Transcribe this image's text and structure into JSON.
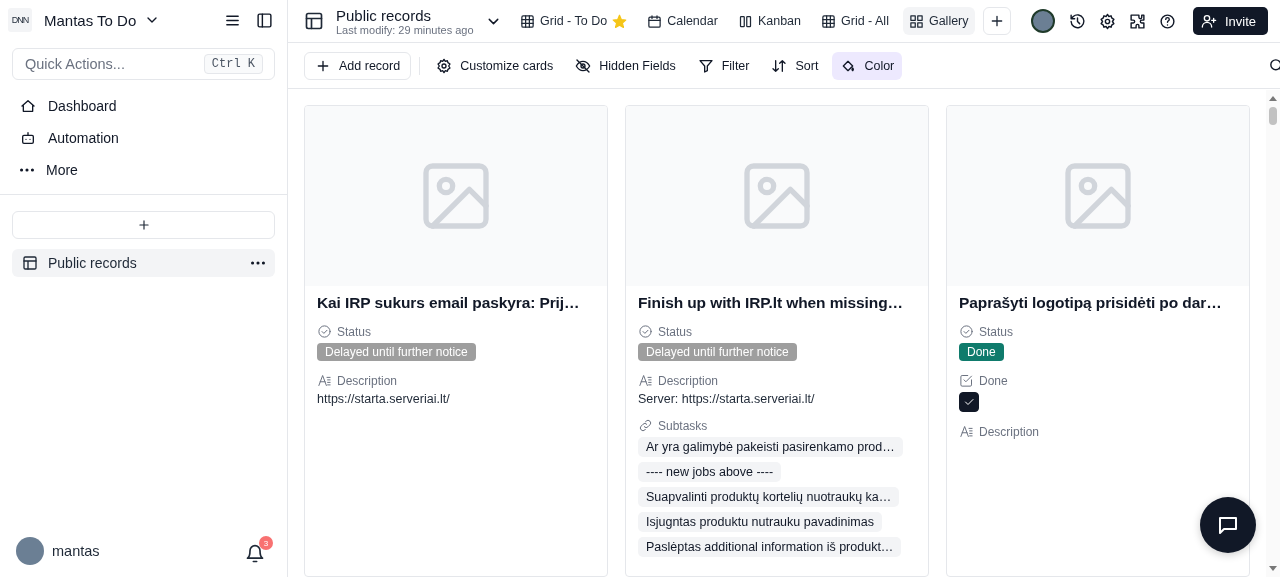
{
  "workspace": {
    "logo": "DNN",
    "name": "Mantas To Do"
  },
  "quick_actions": {
    "placeholder": "Quick Actions...",
    "shortcut": [
      "Ctrl",
      "K"
    ]
  },
  "nav": [
    {
      "label": "Dashboard",
      "kind": "dashboard"
    },
    {
      "label": "Automation",
      "kind": "automation"
    },
    {
      "label": "More",
      "kind": "more"
    }
  ],
  "tables": [
    {
      "label": "Public records",
      "selected": true
    }
  ],
  "user": {
    "name": "mantas",
    "notifications": "3"
  },
  "header": {
    "title": "Public records",
    "subtitle": "Last modify: 29 minutes ago"
  },
  "views": [
    {
      "label": "Grid - To Do",
      "kind": "grid",
      "starred": true,
      "selected": false
    },
    {
      "label": "Calendar",
      "kind": "calendar",
      "starred": false,
      "selected": false
    },
    {
      "label": "Kanban",
      "kind": "kanban",
      "starred": false,
      "selected": false
    },
    {
      "label": "Grid - All",
      "kind": "grid",
      "starred": false,
      "selected": false
    },
    {
      "label": "Gallery",
      "kind": "gallery",
      "starred": false,
      "selected": true
    }
  ],
  "invite": "Invite",
  "toolbar": [
    {
      "label": "Add record",
      "kind": "add",
      "selected": false
    },
    {
      "label": "Customize cards",
      "kind": "customize",
      "selected": false
    },
    {
      "label": "Hidden Fields",
      "kind": "hidden",
      "selected": false
    },
    {
      "label": "Filter",
      "kind": "filter",
      "selected": false
    },
    {
      "label": "Sort",
      "kind": "sort",
      "selected": false
    },
    {
      "label": "Color",
      "kind": "color",
      "selected": true
    }
  ],
  "cards": [
    {
      "title": "Kai IRP sukurs email paskyra: Prij…",
      "fields": [
        {
          "label": "Status",
          "kind": "status",
          "value": "Delayed until further notice",
          "color": "#9e9e9e"
        },
        {
          "label": "Description",
          "kind": "text",
          "value": "https://starta.serveriai.lt/"
        }
      ]
    },
    {
      "title": "Finish up with IRP.lt when missing…",
      "fields": [
        {
          "label": "Status",
          "kind": "status",
          "value": "Delayed until further notice",
          "color": "#9e9e9e"
        },
        {
          "label": "Description",
          "kind": "text",
          "value": "Server: https://starta.serveriai.lt/"
        },
        {
          "label": "Subtasks",
          "kind": "links",
          "items": [
            "Ar yra galimybė pakeisti pasirenkamo prod…",
            "---- new jobs above ----",
            "Suapvalinti produktų kortelių nuotraukų ka…",
            "Isjugntas produktu nutrauku pavadinimas",
            "Paslėptas additional information iš produkt…"
          ]
        }
      ]
    },
    {
      "title": "Paprašyti logotipą prisidėti po dar…",
      "fields": [
        {
          "label": "Status",
          "kind": "status",
          "value": "Done",
          "color": "#0f7b6c"
        },
        {
          "label": "Done",
          "kind": "checkbox",
          "checked": true
        },
        {
          "label": "Description",
          "kind": "text"
        }
      ]
    }
  ]
}
